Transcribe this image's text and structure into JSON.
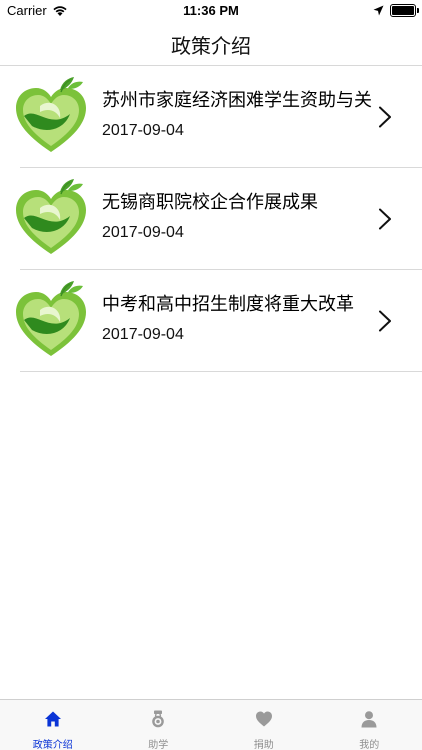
{
  "status_bar": {
    "carrier": "Carrier",
    "time": "11:36 PM"
  },
  "nav": {
    "title": "政策介绍"
  },
  "list": {
    "items": [
      {
        "title": "苏州市家庭经济困难学生资助与关",
        "date": "2017-09-04",
        "icon": "green-heart-logo"
      },
      {
        "title": "无锡商职院校企合作展成果",
        "date": "2017-09-04",
        "icon": "green-heart-logo"
      },
      {
        "title": "中考和高中招生制度将重大改革",
        "date": "2017-09-04",
        "icon": "green-heart-logo"
      }
    ]
  },
  "tab_bar": {
    "active_color": "#0a34d6",
    "inactive_color": "#8e8e8e",
    "tabs": [
      {
        "label": "政策介绍",
        "icon": "home-icon",
        "active": true
      },
      {
        "label": "助学",
        "icon": "medal-icon",
        "active": false
      },
      {
        "label": "捐助",
        "icon": "heart-icon",
        "active": false
      },
      {
        "label": "我的",
        "icon": "person-icon",
        "active": false
      }
    ]
  }
}
